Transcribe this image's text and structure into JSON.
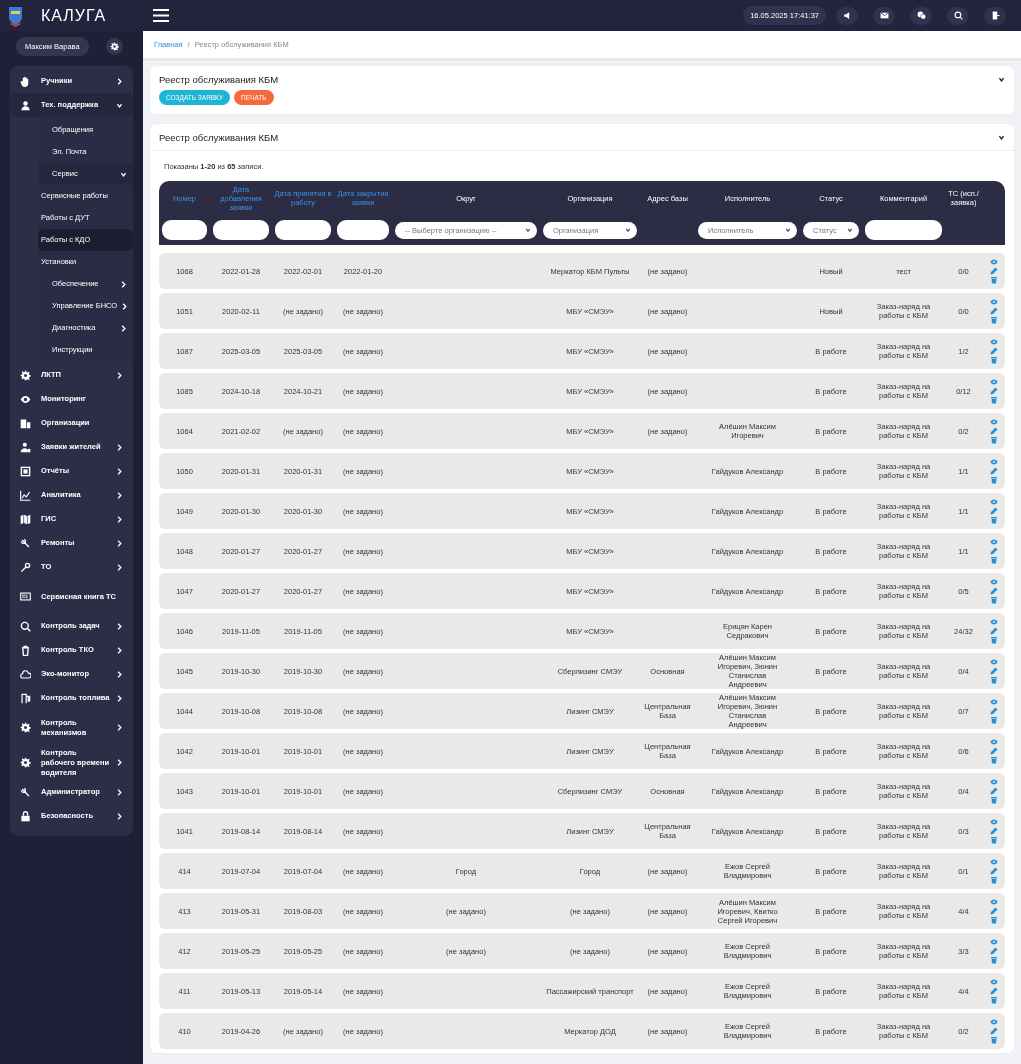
{
  "topbar": {
    "brand": "КАЛУГА",
    "datetime": "16.05.2025 17:41:37"
  },
  "sidebar": {
    "user": "Максим Варава",
    "items": [
      {
        "label": "Ручники",
        "expanded": false,
        "selected": false
      },
      {
        "label": "Тех. поддержка",
        "expanded": true,
        "selected": false,
        "children": [
          {
            "label": "Обращения",
            "selected": false
          },
          {
            "label": "Эл. Почта",
            "selected": false
          },
          {
            "label": "Сервис",
            "expanded": true,
            "selected": false,
            "children": [
              {
                "label": "Сервисные работы",
                "selected": false
              },
              {
                "label": "Работы с ДУТ",
                "selected": false
              },
              {
                "label": "Работы с КДО",
                "selected": true
              },
              {
                "label": "Установки",
                "selected": false
              }
            ]
          },
          {
            "label": "Обеспечение",
            "expanded": false,
            "selected": false
          },
          {
            "label": "Управление БНСО",
            "expanded": false,
            "selected": false
          },
          {
            "label": "Диагностика",
            "expanded": false,
            "selected": false
          },
          {
            "label": "Инструкции",
            "selected": false
          }
        ]
      },
      {
        "label": "ЛКТП",
        "expanded": false,
        "selected": false
      },
      {
        "label": "Мониторинг",
        "selected": false
      },
      {
        "label": "Организации",
        "selected": false
      },
      {
        "label": "Заявки жителей",
        "expanded": false,
        "selected": false
      },
      {
        "label": "Отчёты",
        "expanded": false,
        "selected": false
      },
      {
        "label": "Аналитика",
        "expanded": false,
        "selected": false
      },
      {
        "label": "ГИС",
        "expanded": false,
        "selected": false
      },
      {
        "label": "Ремонты",
        "expanded": false,
        "selected": false
      },
      {
        "label": "ТО",
        "expanded": false,
        "selected": false
      },
      {
        "label": "Сервисная книга ТС",
        "selected": false
      },
      {
        "label": "Контроль задач",
        "expanded": false,
        "selected": false
      },
      {
        "label": "Контроль ТКО",
        "expanded": false,
        "selected": false
      },
      {
        "label": "Эко-монитор",
        "expanded": false,
        "selected": false
      },
      {
        "label": "Контроль топлива",
        "expanded": false,
        "selected": false
      },
      {
        "label": "Контроль механизмов",
        "expanded": false,
        "selected": false
      },
      {
        "label": "Контроль рабочего времени водителя",
        "expanded": false,
        "selected": false
      },
      {
        "label": "Администратор",
        "expanded": false,
        "selected": false
      },
      {
        "label": "Безопасность",
        "expanded": false,
        "selected": false
      }
    ]
  },
  "breadcrumb": [
    {
      "label": "Главная",
      "kind": "link"
    },
    {
      "label": "/",
      "kind": "separator"
    },
    {
      "label": "Реестр обслуживания КБМ",
      "kind": "current"
    }
  ],
  "actions_panel": {
    "title": "Реестр обслуживания КБМ",
    "buttons": [
      {
        "label": "СОЗДАТЬ ЗАЯВКУ",
        "kind": "primary"
      },
      {
        "label": "ПЕЧАТЬ",
        "kind": "print"
      }
    ]
  },
  "registry_panel": {
    "title": "Реестр обслуживания КБМ",
    "summary": "Показаны **1-20** из **65** записи.",
    "table": {
      "columns": [
        {
          "label": "Номер",
          "kind": "sortable"
        },
        {
          "label": "Дата добавления заявки",
          "kind": "sortable"
        },
        {
          "label": "Дата принятия в работу",
          "kind": "sortable"
        },
        {
          "label": "Дата закрытия заявки",
          "kind": "sortable"
        },
        {
          "label": "Округ",
          "kind": "plain"
        },
        {
          "label": "Организация",
          "kind": "plain"
        },
        {
          "label": "Адрес базы",
          "kind": "plain"
        },
        {
          "label": "Исполнитель",
          "kind": "plain"
        },
        {
          "label": "Статус",
          "kind": "plain"
        },
        {
          "label": "Комментарий",
          "kind": "plain"
        },
        {
          "label": "ТС (исп./заявка)",
          "kind": "plain"
        }
      ],
      "filters": [
        {
          "kind": "input"
        },
        {
          "kind": "input"
        },
        {
          "kind": "input"
        },
        {
          "kind": "input"
        },
        {
          "kind": "select",
          "placeholder": "-- Выберте организацию --"
        },
        {
          "kind": "select",
          "placeholder": "Организация"
        },
        {
          "kind": "none"
        },
        {
          "kind": "select",
          "placeholder": "Исполнитель"
        },
        {
          "kind": "select",
          "placeholder": "Статус"
        },
        {
          "kind": "input"
        },
        {
          "kind": "none"
        }
      ],
      "rows": [
        [
          "1068",
          "2022-01-28",
          "2022-02-01",
          "2022-01-20",
          null,
          "Меркатор КБМ Пульты",
          "(не задано)",
          null,
          "Новый",
          "тест",
          "0/0"
        ],
        [
          "1051",
          "2020-02-11",
          "(не задано)",
          "(не задано)",
          null,
          "МБУ «СМЭУ»",
          "(не задано)",
          null,
          "Новый",
          "Заказ-наряд на работы с КБМ",
          "0/0"
        ],
        [
          "1087",
          "2025-03-05",
          "2025-03-05",
          "(не задано)",
          null,
          "МБУ «СМЭУ»",
          "(не задано)",
          null,
          "В работе",
          "Заказ-наряд на работы с КБМ",
          "1/2"
        ],
        [
          "1085",
          "2024-10-18",
          "2024-10-21",
          "(не задано)",
          null,
          "МБУ «СМЭУ»",
          "(не задано)",
          null,
          "В работе",
          "Заказ-наряд на работы с КБМ",
          "0/12"
        ],
        [
          "1064",
          "2021-02-02",
          "(не задано)",
          "(не задано)",
          null,
          "МБУ «СМЭУ»",
          "(не задано)",
          "Алёшин Максим Игоревич",
          "В работе",
          "Заказ-наряд на работы с КБМ",
          "0/2"
        ],
        [
          "1050",
          "2020-01-31",
          "2020-01-31",
          "(не задано)",
          null,
          "МБУ «СМЭУ»",
          null,
          "Гайдуков Александр",
          "В работе",
          "Заказ-наряд на работы с КБМ",
          "1/1"
        ],
        [
          "1049",
          "2020-01-30",
          "2020-01-30",
          "(не задано)",
          null,
          "МБУ «СМЭУ»",
          null,
          "Гайдуков Александр",
          "В работе",
          "Заказ-наряд на работы с КБМ",
          "1/1"
        ],
        [
          "1048",
          "2020-01-27",
          "2020-01-27",
          "(не задано)",
          null,
          "МБУ «СМЭУ»",
          null,
          "Гайдуков Александр",
          "В работе",
          "Заказ-наряд на работы с КБМ",
          "1/1"
        ],
        [
          "1047",
          "2020-01-27",
          "2020-01-27",
          "(не задано)",
          null,
          "МБУ «СМЭУ»",
          null,
          "Гайдуков Александр",
          "В работе",
          "Заказ-наряд на работы с КБМ",
          "0/5"
        ],
        [
          "1046",
          "2019-11-05",
          "2019-11-05",
          "(не задано)",
          null,
          "МБУ «СМЭУ»",
          null,
          "Ерицян Карен Седракович",
          "В работе",
          "Заказ-наряд на работы с КБМ",
          "24/32"
        ],
        [
          "1045",
          "2019-10-30",
          "2019-10-30",
          "(не задано)",
          null,
          "Сберлизинг СМЭУ",
          "Основная",
          "Алёшин Максим Игоревич, Зюнин Станислав Андреевич",
          "В работе",
          "Заказ-наряд на работы с КБМ",
          "0/4"
        ],
        [
          "1044",
          "2019-10-08",
          "2019-10-08",
          "(не задано)",
          null,
          "Лизинг СМЭУ",
          "Центральная База",
          "Алёшин Максим Игоревич, Зюнин Станислав Андреевич",
          "В работе",
          "Заказ-наряд на работы с КБМ",
          "0/7"
        ],
        [
          "1042",
          "2019-10-01",
          "2019-10-01",
          "(не задано)",
          null,
          "Лизинг СМЭУ",
          "Центральная База",
          "Гайдуков Александр",
          "В работе",
          "Заказ-наряд на работы с КБМ",
          "0/6"
        ],
        [
          "1043",
          "2019-10-01",
          "2019-10-01",
          "(не задано)",
          null,
          "Сберлизинг СМЭУ",
          "Основная",
          "Гайдуков Александр",
          "В работе",
          "Заказ-наряд на работы с КБМ",
          "0/4"
        ],
        [
          "1041",
          "2019-08-14",
          "2019-08-14",
          "(не задано)",
          null,
          "Лизинг СМЭУ",
          "Центральная База",
          "Гайдуков Александр",
          "В работе",
          "Заказ-наряд на работы с КБМ",
          "0/3"
        ],
        [
          "414",
          "2019-07-04",
          "2019-07-04",
          "(не задано)",
          "Город",
          "Город",
          "(не задано)",
          "Ежов Сергей Владмирович",
          "В работе",
          "Заказ-наряд на работы с КБМ",
          "0/1"
        ],
        [
          "413",
          "2019-05-31",
          "2019-08-03",
          "(не задано)",
          "(не задано)",
          "(не задано)",
          "(не задано)",
          "Алёшин Максим Игоревич, Квитко Сергей Игоревич",
          "В работе",
          "Заказ-наряд на работы с КБМ",
          "4/4"
        ],
        [
          "412",
          "2019-05-25",
          "2019-05-25",
          "(не задано)",
          "(не задано)",
          "(не задано)",
          "(не задано)",
          "Ежов Сергей Владмирович",
          "В работе",
          "Заказ-наряд на работы с КБМ",
          "3/3"
        ],
        [
          "411",
          "2019-05-13",
          "2019-05-14",
          "(не задано)",
          null,
          "Пассажирский транспорт",
          "(не задано)",
          "Ежов Сергей Владмирович",
          "В работе",
          "Заказ-наряд на работы с КБМ",
          "4/4"
        ],
        [
          "410",
          "2019-04-26",
          "(не задано)",
          "(не задано)",
          null,
          "Меркатор ДОД",
          "(не задано)",
          "Ежов Сергей Владмирович",
          "В работе",
          "Заказ-наряд на работы с КБМ",
          "0/2"
        ]
      ]
    }
  }
}
